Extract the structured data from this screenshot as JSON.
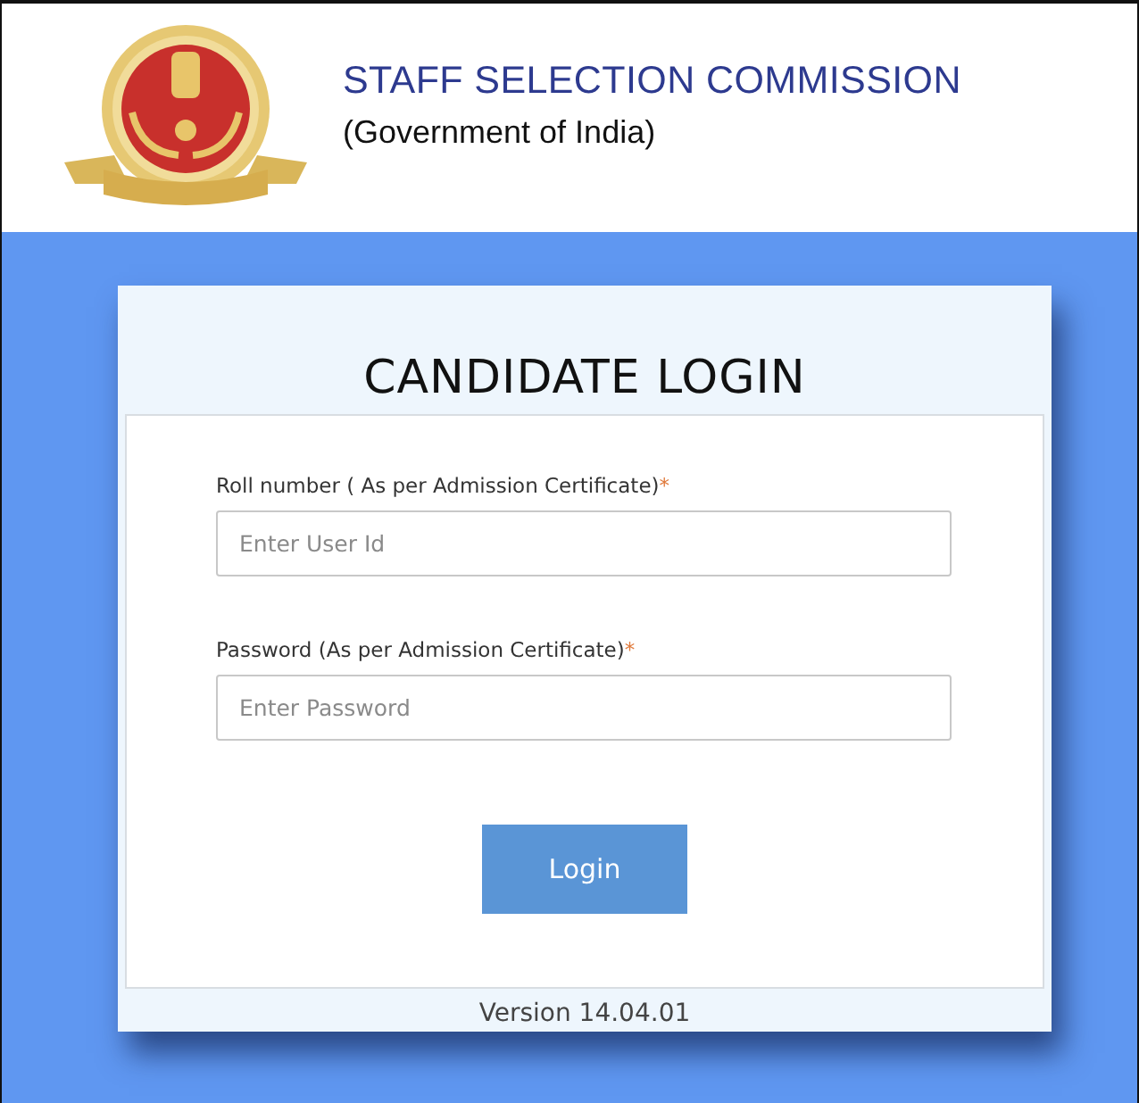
{
  "header": {
    "title": "STAFF SELECTION COMMISSION",
    "subtitle": "(Government of India)"
  },
  "login": {
    "title": "CANDIDATE LOGIN",
    "fields": [
      {
        "label": "Roll number ( As per Admission Certificate)",
        "required_mark": "*",
        "placeholder": "Enter User Id"
      },
      {
        "label": "Password (As per Admission Certificate)",
        "required_mark": "*",
        "placeholder": "Enter Password"
      }
    ],
    "button": "Login",
    "version": "Version 14.04.01"
  }
}
